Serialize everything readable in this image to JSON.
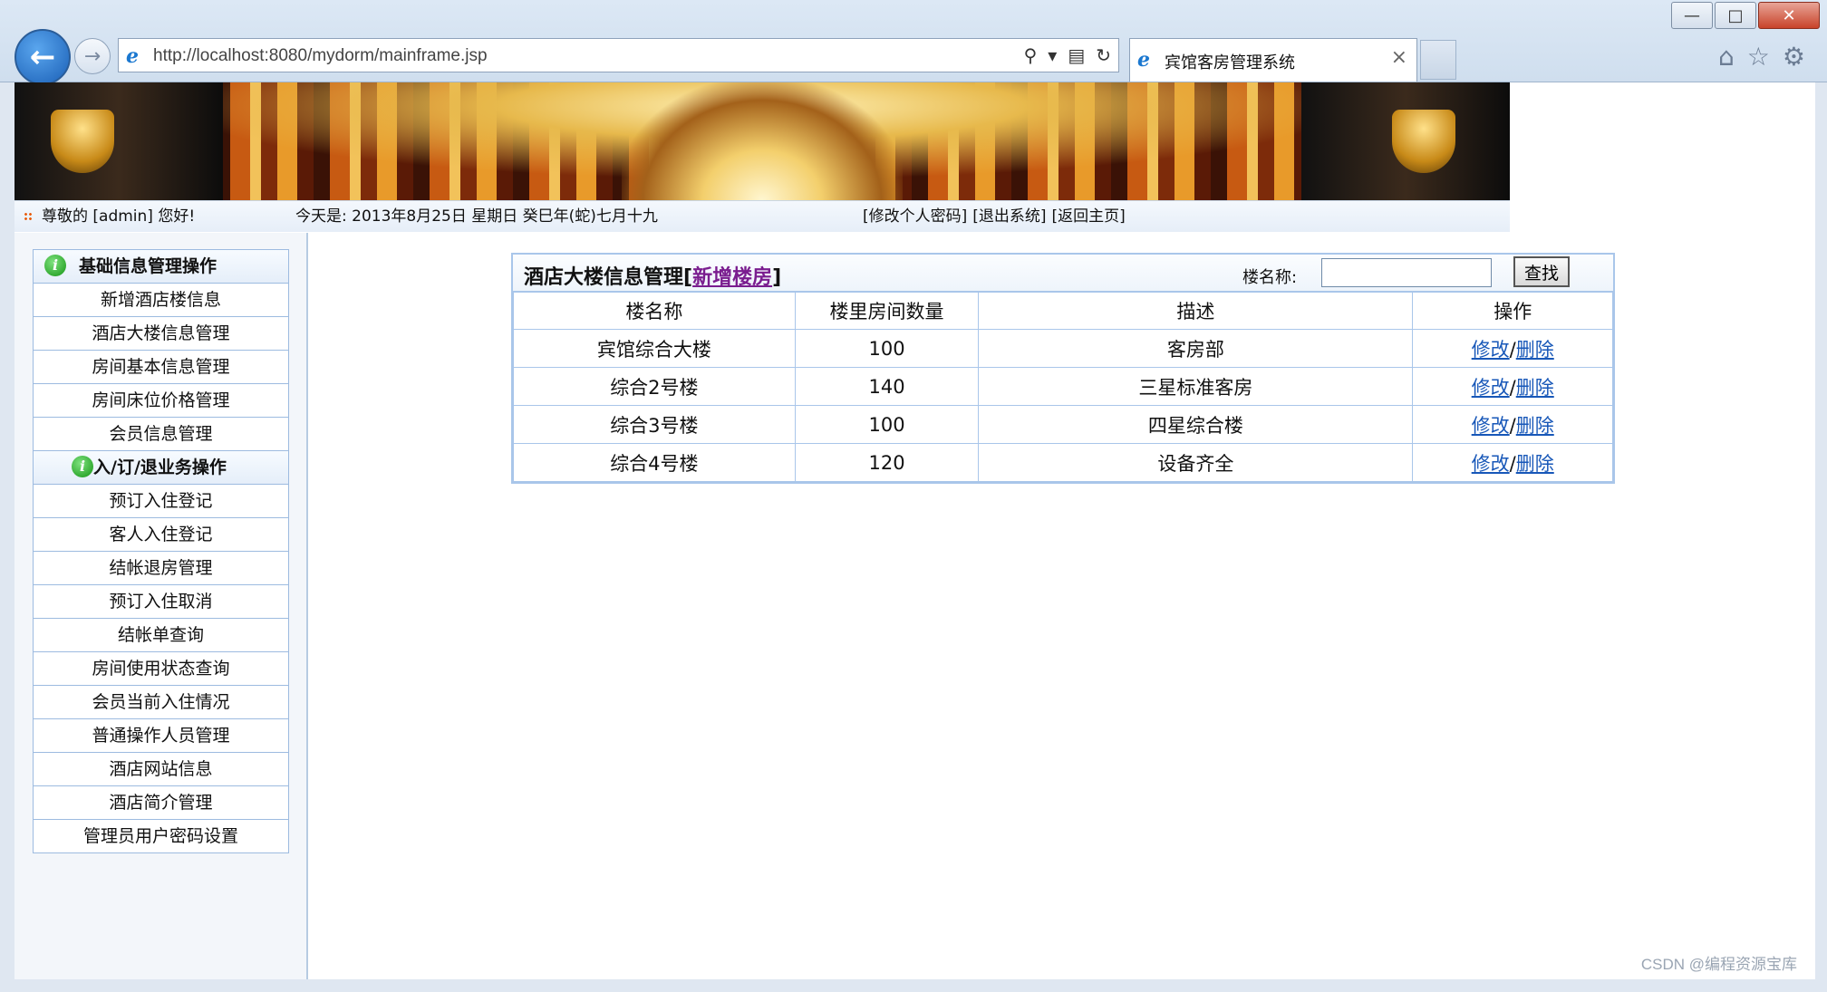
{
  "browser": {
    "url": "http://localhost:8080/mydorm/mainframe.jsp",
    "tab_title": "宾馆客房管理系统",
    "tab_close": "×"
  },
  "status": {
    "greeting": "尊敬的 [admin] 您好!",
    "date": "今天是:  2013年8月25日  星期日  癸巳年(蛇)七月十九",
    "links": [
      "[修改个人密码]",
      "[退出系统]",
      "[返回主页]"
    ]
  },
  "sidebar": {
    "section1_title": "基础信息管理操作",
    "section1_items": [
      "新增酒店楼信息",
      "酒店大楼信息管理",
      "房间基本信息管理",
      "房间床位价格管理",
      "会员信息管理"
    ],
    "section2_title": "入/订/退业务操作",
    "section2_items": [
      "预订入住登记",
      "客人入住登记",
      "结帐退房管理",
      "预订入住取消",
      "结帐单查询",
      "房间使用状态查询",
      "会员当前入住情况",
      "普通操作人员管理",
      "酒店网站信息",
      "酒店简介管理",
      "管理员用户密码设置"
    ]
  },
  "main": {
    "title_prefix": "酒店大楼信息管理[",
    "title_link": "新增楼房",
    "title_suffix": "]",
    "search_label": "楼名称:",
    "search_value": "",
    "search_button": "查找",
    "columns": [
      "楼名称",
      "楼里房间数量",
      "描述",
      "操作"
    ],
    "rows": [
      {
        "name": "宾馆综合大楼",
        "count": "100",
        "desc": "客房部"
      },
      {
        "name": "综合2号楼",
        "count": "140",
        "desc": "三星标准客房"
      },
      {
        "name": "综合3号楼",
        "count": "100",
        "desc": "四星综合楼"
      },
      {
        "name": "综合4号楼",
        "count": "120",
        "desc": "设备齐全"
      }
    ],
    "edit_label": "修改",
    "separator": "/",
    "delete_label": "删除"
  },
  "watermark": "CSDN @编程资源宝库"
}
